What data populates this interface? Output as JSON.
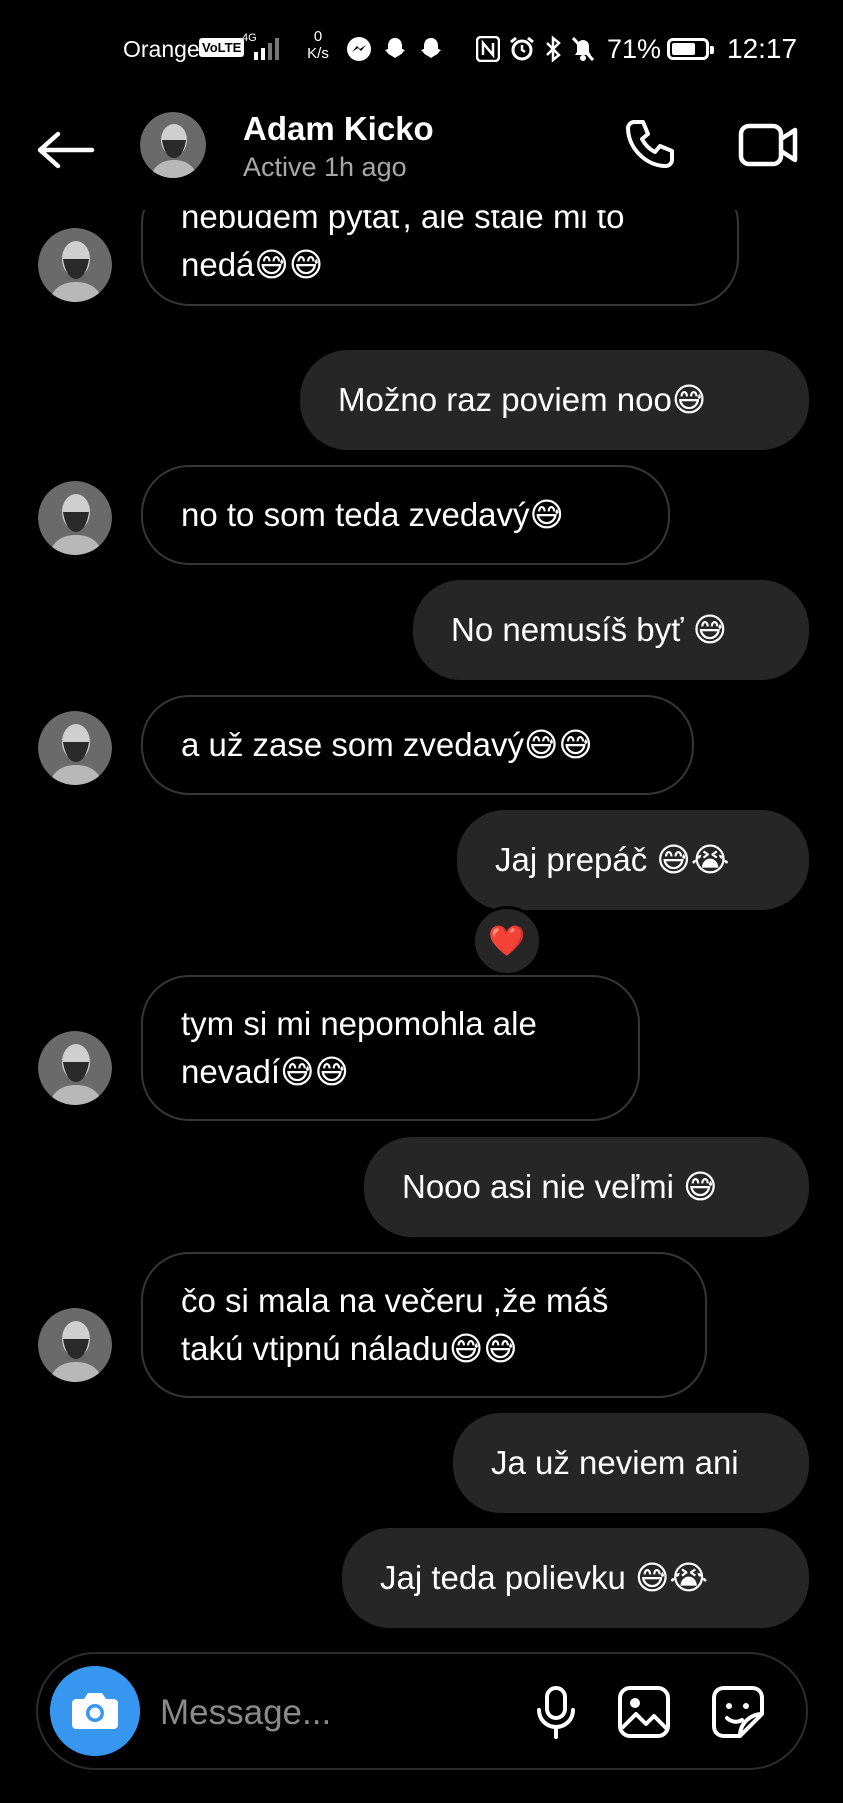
{
  "status_bar": {
    "carrier": "Orange",
    "volte": "VoLTE",
    "network": "4G",
    "speed_value": "0",
    "speed_unit": "K/s",
    "battery_percent": "71%",
    "battery_level": 0.71,
    "time": "12:17"
  },
  "header": {
    "contact_name": "Adam Kicko",
    "contact_status": "Active 1h ago"
  },
  "messages": [
    {
      "side": "in",
      "text": "nebudem pýtať, ale stále mi to\nnedá😅😅"
    },
    {
      "side": "out",
      "text": "Možno raz poviem noo😅"
    },
    {
      "side": "in",
      "text": "no to som teda zvedavý😅"
    },
    {
      "side": "out",
      "text": "No nemusíš byť 😅"
    },
    {
      "side": "in",
      "text": "a už zase som zvedavý😅😅"
    },
    {
      "side": "out",
      "text": "Jaj prepáč 😅😭",
      "reaction": "❤️"
    },
    {
      "side": "in",
      "text": "tym si mi nepomohla ale\nnevadí😅😅"
    },
    {
      "side": "out",
      "text": "Nooo asi nie veľmi 😅"
    },
    {
      "side": "in",
      "text": "čo si mala na večeru ,že máš\ntakú vtipnú náladu😅😅"
    },
    {
      "side": "out",
      "text": "Ja už neviem ani"
    },
    {
      "side": "out",
      "text": "Jaj teda polievku 😅😭"
    }
  ],
  "composer": {
    "placeholder": "Message..."
  },
  "colors": {
    "background": "#000000",
    "outgoing_bubble": "#262626",
    "incoming_border": "#363636",
    "camera_button": "#3797f0"
  },
  "icons": [
    "back-arrow-icon",
    "phone-icon",
    "video-camera-icon",
    "camera-icon",
    "microphone-icon",
    "gallery-icon",
    "sticker-icon"
  ]
}
